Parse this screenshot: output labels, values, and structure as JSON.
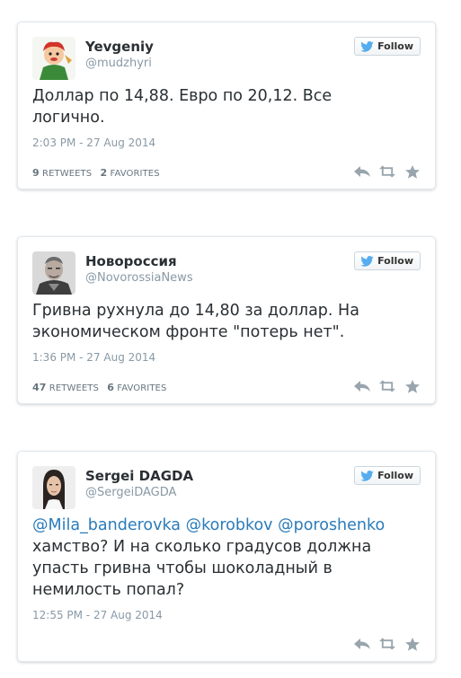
{
  "follow_label": "Follow",
  "colors": {
    "accent": "#55acee",
    "mention": "#2b7bb9",
    "muted": "#8899a6",
    "icon": "#99a5ad"
  },
  "tweets": [
    {
      "name": "Yevgeniy",
      "handle": "@mudzhyri",
      "avatar": "cartoon-character-avatar",
      "text_lines": [
        "Доллар по 14,88. Евро по 20,12. Все",
        "логично."
      ],
      "timestamp": "2:03 PM - 27 Aug 2014",
      "retweets": "9",
      "retweets_label": "RETWEETS",
      "favorites": "2",
      "favorites_label": "FAVORITES"
    },
    {
      "name": "Новороссия",
      "handle": "@NovorossiaNews",
      "avatar": "military-man-avatar",
      "text_lines": [
        "Гривна рухнула до 14,80 за доллар. На",
        "экономическом фронте \"потерь нет\"."
      ],
      "timestamp": "1:36 PM - 27 Aug 2014",
      "retweets": "47",
      "retweets_label": "RETWEETS",
      "favorites": "6",
      "favorites_label": "FAVORITES"
    },
    {
      "name": "Sergei DAGDA",
      "handle": "@SergeiDAGDA",
      "avatar": "long-hair-man-avatar",
      "mentions": [
        "@Mila_banderovka",
        "@korobkov",
        "@poroshenko"
      ],
      "text_lines": [
        "хамство? И на сколько градусов должна",
        "упасть гривна чтобы шоколадный в",
        "немилость попал?"
      ],
      "timestamp": "12:55 PM - 27 Aug 2014"
    }
  ]
}
